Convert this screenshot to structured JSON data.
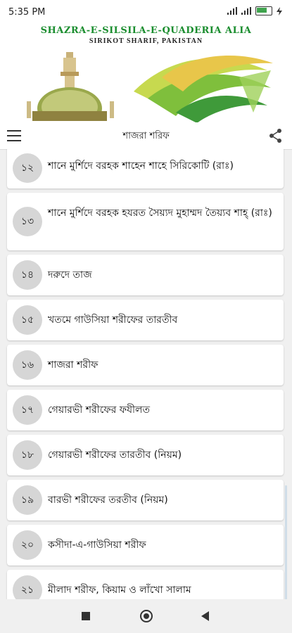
{
  "status": {
    "time": "5:35 PM",
    "battery": "93"
  },
  "banner": {
    "title": "SHAZRA-E-SILSILA-E-QUADERIA ALIA",
    "subtitle": "SIRIKOT SHARIF, PAKISTAN"
  },
  "app_bar": {
    "title": "শাজরা শরিফ",
    "menu_icon": "hamburger-menu-icon",
    "share_icon": "share-icon"
  },
  "items": [
    {
      "num": "১২",
      "label": "শানে মুর্শিদে বরহক শাহেন শাহে সিরিকোটি (রাঃ)"
    },
    {
      "num": "১৩",
      "label": "শানে মুর্শিদে বরহক হযরত সৈয়্যদ মুহাম্মদ তৈয়্যব শাহ্ (রাঃ)"
    },
    {
      "num": "১৪",
      "label": "দরুদে তাজ"
    },
    {
      "num": "১৫",
      "label": "খতমে গাউসিয়া শরীফের তারতীব"
    },
    {
      "num": "১৬",
      "label": "শাজরা শরীফ"
    },
    {
      "num": "১৭",
      "label": "গেয়ারভী শরীফের ফযীলত"
    },
    {
      "num": "১৮",
      "label": "গেয়ারভী শরীফের তারতীব (নিয়ম)"
    },
    {
      "num": "১৯",
      "label": "বারভী শরীফের তরতীব (নিয়ম)"
    },
    {
      "num": "২০",
      "label": "কসীদা-এ-গাউসিয়া শরীফ"
    },
    {
      "num": "২১",
      "label": "মীলাদ শরীফ, কিয়াম ও লাঁখো সালাম"
    }
  ],
  "colors": {
    "banner_title": "#1a8d2e",
    "number_circle": "#d6d6d6"
  }
}
